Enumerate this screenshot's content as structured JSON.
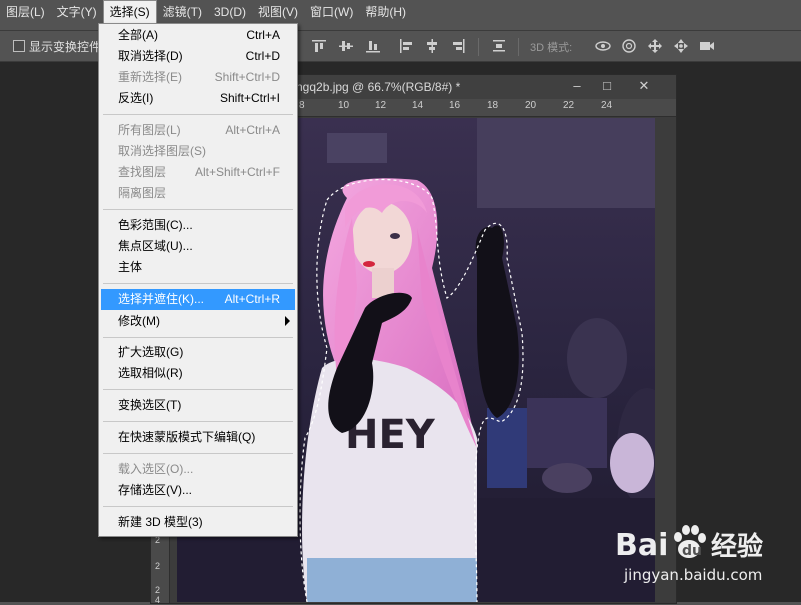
{
  "menubar": [
    {
      "label": "图层(L)"
    },
    {
      "label": "文字(Y)"
    },
    {
      "label": "选择(S)"
    },
    {
      "label": "滤镜(T)"
    },
    {
      "label": "3D(D)"
    },
    {
      "label": "视图(V)"
    },
    {
      "label": "窗口(W)"
    },
    {
      "label": "帮助(H)"
    }
  ],
  "options_bar": {
    "show_transform_label": "显示变换控件",
    "mode_3d_label": "3D 模式:"
  },
  "document": {
    "title": "ngq2b.jpg @ 66.7%(RGB/8#) *",
    "ruler_top": [
      "8",
      "10",
      "12",
      "14",
      "16",
      "18",
      "20",
      "22",
      "24"
    ],
    "ruler_left": [
      "2",
      "2",
      "2",
      "4"
    ],
    "window_controls": [
      "–",
      "□",
      "✕"
    ]
  },
  "select_menu": {
    "items": [
      {
        "label": "全部(A)",
        "shortcut": "Ctrl+A",
        "disabled": false
      },
      {
        "label": "取消选择(D)",
        "shortcut": "Ctrl+D",
        "disabled": false
      },
      {
        "label": "重新选择(E)",
        "shortcut": "Shift+Ctrl+D",
        "disabled": true
      },
      {
        "label": "反选(I)",
        "shortcut": "Shift+Ctrl+I",
        "disabled": false
      },
      {
        "label": "所有图层(L)",
        "shortcut": "Alt+Ctrl+A",
        "disabled": true
      },
      {
        "label": "取消选择图层(S)",
        "shortcut": "",
        "disabled": true
      },
      {
        "label": "查找图层",
        "shortcut": "Alt+Shift+Ctrl+F",
        "disabled": true
      },
      {
        "label": "隔离图层",
        "shortcut": "",
        "disabled": true
      },
      {
        "label": "色彩范围(C)...",
        "shortcut": "",
        "disabled": false
      },
      {
        "label": "焦点区域(U)...",
        "shortcut": "",
        "disabled": false
      },
      {
        "label": "主体",
        "shortcut": "",
        "disabled": false
      },
      {
        "label": "选择并遮住(K)...",
        "shortcut": "Alt+Ctrl+R",
        "disabled": false,
        "highlighted": true
      },
      {
        "label": "修改(M)",
        "shortcut": "",
        "disabled": false,
        "submenu": true
      },
      {
        "label": "扩大选取(G)",
        "shortcut": "",
        "disabled": false
      },
      {
        "label": "选取相似(R)",
        "shortcut": "",
        "disabled": false
      },
      {
        "label": "变换选区(T)",
        "shortcut": "",
        "disabled": false
      },
      {
        "label": "在快速蒙版模式下编辑(Q)",
        "shortcut": "",
        "disabled": false
      },
      {
        "label": "载入选区(O)...",
        "shortcut": "",
        "disabled": true
      },
      {
        "label": "存储选区(V)...",
        "shortcut": "",
        "disabled": false
      },
      {
        "label": "新建 3D 模型(3)",
        "shortcut": "",
        "disabled": false
      }
    ]
  },
  "canvas": {
    "shirt_text": "HEY"
  },
  "watermark": {
    "logo_text": "Bai经验",
    "url": "jingyan.baidu.com"
  },
  "colors": {
    "menu_highlight": "#3399ff",
    "hair": "#e58ad0",
    "background_room": "#2a2540"
  }
}
